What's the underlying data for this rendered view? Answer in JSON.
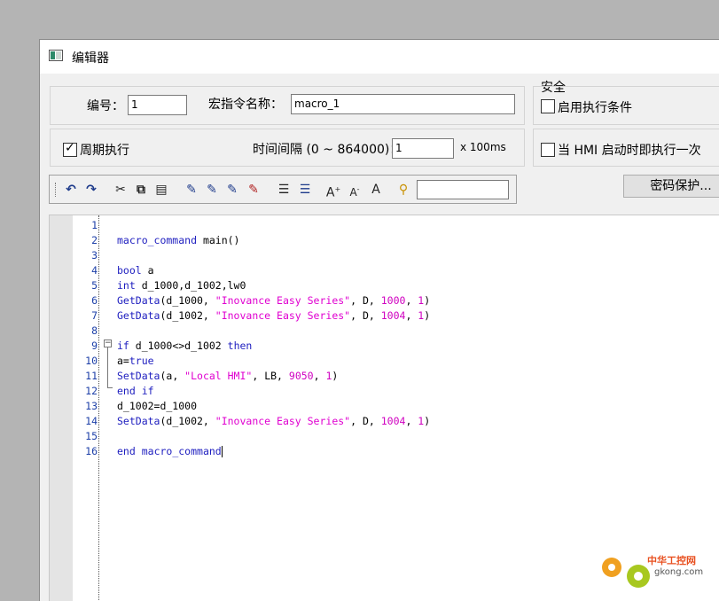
{
  "window": {
    "title": "编辑器"
  },
  "form": {
    "number_label": "编号：",
    "number_value": "1",
    "macro_name_label": "宏指令名称：",
    "macro_name_value": "macro_1",
    "periodic_label": "周期执行",
    "periodic_checked": true,
    "interval_label": "时间间隔 (0 ~ 864000)：",
    "interval_value": "1",
    "interval_unit": "x 100ms"
  },
  "security": {
    "title": "安全",
    "enable_condition_label": "启用执行条件",
    "run_once_label": "当 HMI 启动时即执行一次",
    "password_button": "密码保护..."
  },
  "toolbar": {
    "icons": [
      "undo-icon",
      "redo-icon",
      "cut-icon",
      "copy-icon",
      "paste-icon",
      "bookmark-toggle-icon",
      "bookmark-next-icon",
      "bookmark-prev-icon",
      "bookmark-clear-icon",
      "indent-icon",
      "outdent-icon",
      "font-increase-icon",
      "font-decrease-icon",
      "font-reset-icon",
      "find-icon"
    ],
    "search_value": ""
  },
  "code": {
    "lines": [
      {
        "n": "1",
        "t": ""
      },
      {
        "n": "2",
        "t": "macro_command main()"
      },
      {
        "n": "3",
        "t": ""
      },
      {
        "n": "4",
        "t": "bool a"
      },
      {
        "n": "5",
        "t": "int d_1000,d_1002,lw0"
      },
      {
        "n": "6",
        "t": "GetData(d_1000, \"Inovance Easy Series\", D, 1000, 1)"
      },
      {
        "n": "7",
        "t": "GetData(d_1002, \"Inovance Easy Series\", D, 1004, 1)"
      },
      {
        "n": "8",
        "t": ""
      },
      {
        "n": "9",
        "t": "if d_1000<>d_1002 then"
      },
      {
        "n": "10",
        "t": "a=true"
      },
      {
        "n": "11",
        "t": "SetData(a, \"Local HMI\", LB, 9050, 1)"
      },
      {
        "n": "12",
        "t": "end if"
      },
      {
        "n": "13",
        "t": "d_1002=d_1000"
      },
      {
        "n": "14",
        "t": "SetData(d_1002, \"Inovance Easy Series\", D, 1004, 1)"
      },
      {
        "n": "15",
        "t": ""
      },
      {
        "n": "16",
        "t": "end macro_command"
      }
    ]
  },
  "watermark": {
    "brand": "中华工控网",
    "domain": "gkong.com"
  }
}
